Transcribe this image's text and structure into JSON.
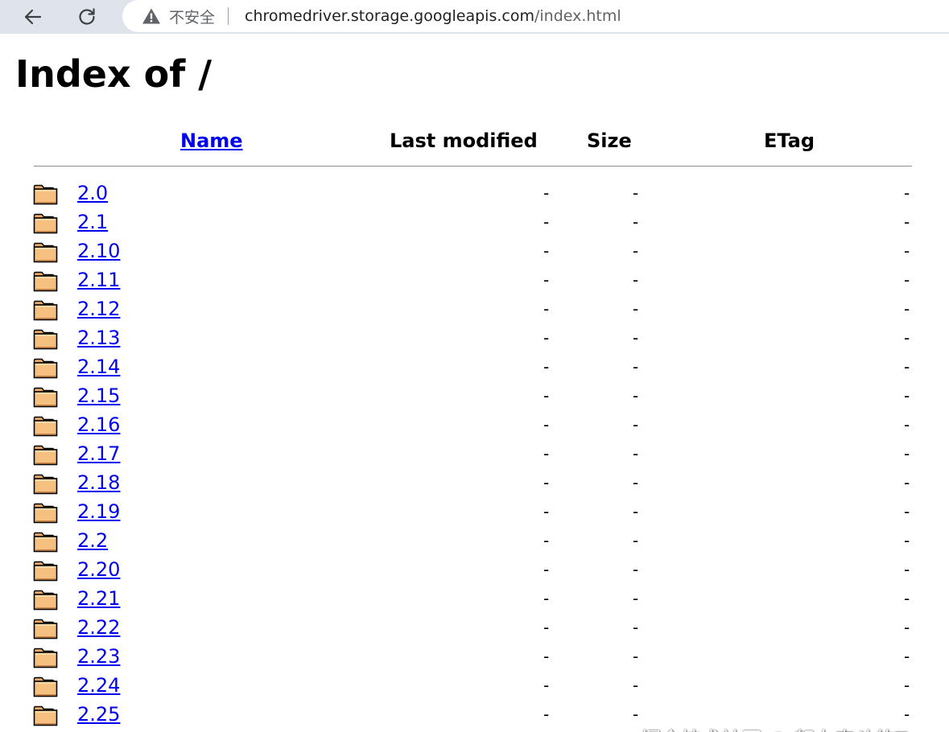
{
  "browser": {
    "security_label": "不安全",
    "url_host": "chromedriver.storage.googleapis.com",
    "url_path": "/index.html"
  },
  "page": {
    "title": "Index of /",
    "columns": {
      "name": "Name",
      "last_modified": "Last modified",
      "size": "Size",
      "etag": "ETag"
    },
    "rows": [
      {
        "name": "2.0",
        "last_modified": "-",
        "size": "-",
        "etag": "-"
      },
      {
        "name": "2.1",
        "last_modified": "-",
        "size": "-",
        "etag": "-"
      },
      {
        "name": "2.10",
        "last_modified": "-",
        "size": "-",
        "etag": "-"
      },
      {
        "name": "2.11",
        "last_modified": "-",
        "size": "-",
        "etag": "-"
      },
      {
        "name": "2.12",
        "last_modified": "-",
        "size": "-",
        "etag": "-"
      },
      {
        "name": "2.13",
        "last_modified": "-",
        "size": "-",
        "etag": "-"
      },
      {
        "name": "2.14",
        "last_modified": "-",
        "size": "-",
        "etag": "-"
      },
      {
        "name": "2.15",
        "last_modified": "-",
        "size": "-",
        "etag": "-"
      },
      {
        "name": "2.16",
        "last_modified": "-",
        "size": "-",
        "etag": "-"
      },
      {
        "name": "2.17",
        "last_modified": "-",
        "size": "-",
        "etag": "-"
      },
      {
        "name": "2.18",
        "last_modified": "-",
        "size": "-",
        "etag": "-"
      },
      {
        "name": "2.19",
        "last_modified": "-",
        "size": "-",
        "etag": "-"
      },
      {
        "name": "2.2",
        "last_modified": "-",
        "size": "-",
        "etag": "-"
      },
      {
        "name": "2.20",
        "last_modified": "-",
        "size": "-",
        "etag": "-"
      },
      {
        "name": "2.21",
        "last_modified": "-",
        "size": "-",
        "etag": "-"
      },
      {
        "name": "2.22",
        "last_modified": "-",
        "size": "-",
        "etag": "-"
      },
      {
        "name": "2.23",
        "last_modified": "-",
        "size": "-",
        "etag": "-"
      },
      {
        "name": "2.24",
        "last_modified": "-",
        "size": "-",
        "etag": "-"
      },
      {
        "name": "2.25",
        "last_modified": "-",
        "size": "-",
        "etag": "-"
      }
    ]
  },
  "watermark": "掘金技术社区 @ 努力奋斗的Tom",
  "icons": {
    "back": "back-arrow-icon",
    "reload": "reload-icon",
    "security": "warning-triangle-icon",
    "row": "folder-icon"
  },
  "colors": {
    "link": "#0000ee",
    "chrome_bar": "#dfe3eb",
    "folder_fill": "#f5c080"
  }
}
